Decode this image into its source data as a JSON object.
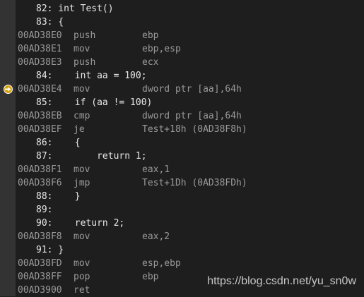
{
  "disassembly": {
    "lines": [
      {
        "kind": "src",
        "text": "82: int Test()"
      },
      {
        "kind": "src",
        "text": "83: {"
      },
      {
        "kind": "asm",
        "addr": "00AD38E0",
        "op": "push",
        "arg": "ebp"
      },
      {
        "kind": "asm",
        "addr": "00AD38E1",
        "op": "mov",
        "arg": "ebp,esp"
      },
      {
        "kind": "asm",
        "addr": "00AD38E3",
        "op": "push",
        "arg": "ecx"
      },
      {
        "kind": "src",
        "text": "84:    int aa = 100;"
      },
      {
        "kind": "asm",
        "addr": "00AD38E4",
        "op": "mov",
        "arg": "dword ptr [aa],64h",
        "current": true
      },
      {
        "kind": "src",
        "text": "85:    if (aa != 100)"
      },
      {
        "kind": "asm",
        "addr": "00AD38EB",
        "op": "cmp",
        "arg": "dword ptr [aa],64h"
      },
      {
        "kind": "asm",
        "addr": "00AD38EF",
        "op": "je",
        "arg": "Test+18h (0AD38F8h)"
      },
      {
        "kind": "src",
        "text": "86:    {"
      },
      {
        "kind": "src",
        "text": "87:        return 1;"
      },
      {
        "kind": "asm",
        "addr": "00AD38F1",
        "op": "mov",
        "arg": "eax,1"
      },
      {
        "kind": "asm",
        "addr": "00AD38F6",
        "op": "jmp",
        "arg": "Test+1Dh (0AD38FDh)"
      },
      {
        "kind": "src",
        "text": "88:    }"
      },
      {
        "kind": "src",
        "text": "89:"
      },
      {
        "kind": "src",
        "text": "90:    return 2;"
      },
      {
        "kind": "asm",
        "addr": "00AD38F8",
        "op": "mov",
        "arg": "eax,2"
      },
      {
        "kind": "src",
        "text": "91: }"
      },
      {
        "kind": "asm",
        "addr": "00AD38FD",
        "op": "mov",
        "arg": "esp,ebp"
      },
      {
        "kind": "asm",
        "addr": "00AD38FF",
        "op": "pop",
        "arg": "ebp"
      },
      {
        "kind": "asm",
        "addr": "00AD3900",
        "op": "ret",
        "arg": ""
      }
    ]
  },
  "current_instruction_icon": "instruction-pointer-arrow-icon",
  "colors": {
    "background": "#1e1e1e",
    "source_text": "#e8e8e8",
    "asm_text": "#9a9a9a",
    "pointer": "#d7a10a"
  },
  "watermark": "https://blog.csdn.net/yu_sn0w"
}
